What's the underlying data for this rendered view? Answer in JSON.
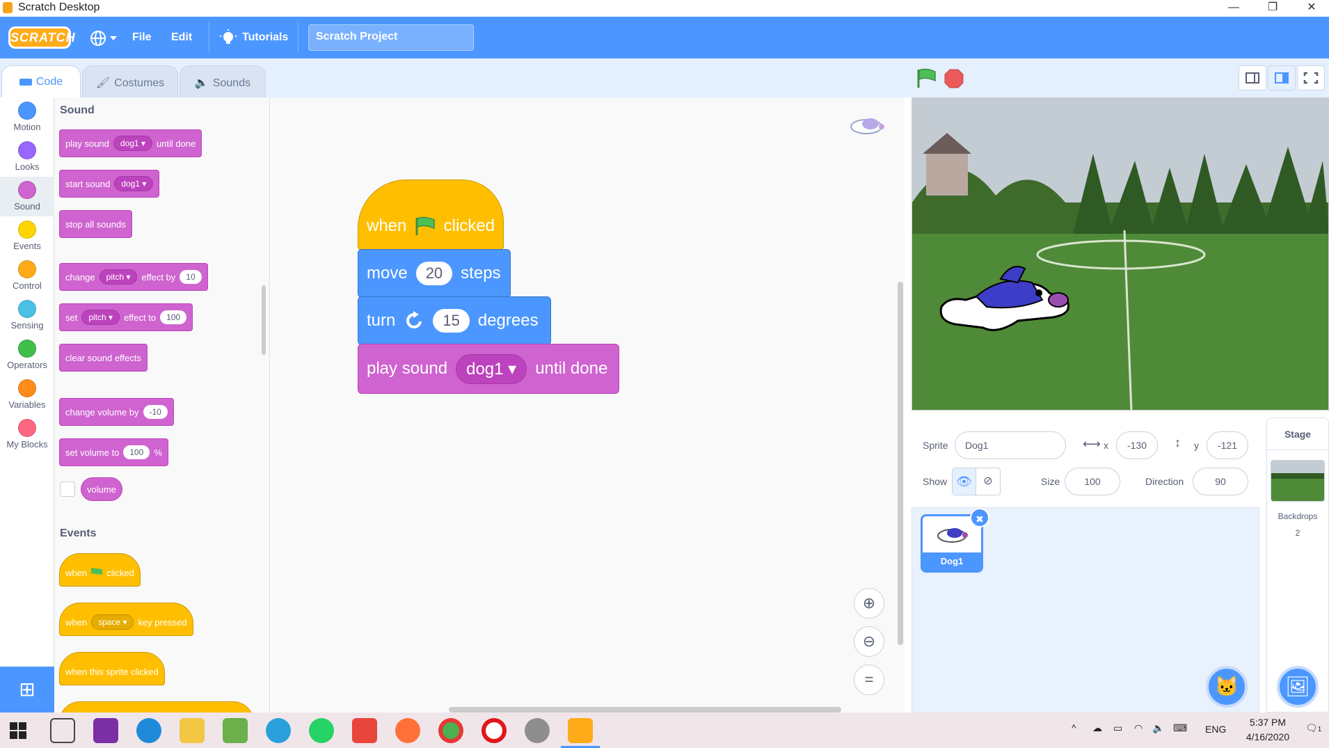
{
  "window": {
    "title": "Scratch Desktop",
    "controls": [
      "—",
      "❐",
      "✕"
    ]
  },
  "menu": {
    "logo": "SCRATCH",
    "file": "File",
    "edit": "Edit",
    "tutorials": "Tutorials",
    "project_name": "Scratch Project"
  },
  "tabs": [
    "Code",
    "Costumes",
    "Sounds"
  ],
  "categories": [
    {
      "label": "Motion",
      "color": "#4c97ff"
    },
    {
      "label": "Looks",
      "color": "#9966ff"
    },
    {
      "label": "Sound",
      "color": "#cf63cf"
    },
    {
      "label": "Events",
      "color": "#ffd500"
    },
    {
      "label": "Control",
      "color": "#ffab19"
    },
    {
      "label": "Sensing",
      "color": "#4cbfe6"
    },
    {
      "label": "Operators",
      "color": "#40bf4a"
    },
    {
      "label": "Variables",
      "color": "#ff8c1a"
    },
    {
      "label": "My Blocks",
      "color": "#ff6680"
    }
  ],
  "palette": {
    "sound_header": "Sound",
    "play_sound": {
      "pre": "play sound",
      "dd": "dog1",
      "post": "until done"
    },
    "start_sound": {
      "pre": "start sound",
      "dd": "dog1"
    },
    "stop_all": "stop all sounds",
    "change_effect": {
      "pre": "change",
      "dd": "pitch",
      "mid": "effect by",
      "val": "10"
    },
    "set_effect": {
      "pre": "set",
      "dd": "pitch",
      "mid": "effect to",
      "val": "100"
    },
    "clear_effects": "clear sound effects",
    "change_volume": {
      "pre": "change volume by",
      "val": "-10"
    },
    "set_volume": {
      "pre": "set volume to",
      "val": "100",
      "post": "%"
    },
    "volume": "volume",
    "events_header": "Events",
    "when_flag": {
      "pre": "when",
      "post": "clicked"
    },
    "when_key": {
      "pre": "when",
      "dd": "space",
      "post": "key pressed"
    },
    "when_sprite": "when this sprite clicked"
  },
  "script": {
    "hat": {
      "pre": "when",
      "post": "clicked"
    },
    "move": {
      "pre": "move",
      "val": "20",
      "post": "steps"
    },
    "turn": {
      "pre": "turn",
      "val": "15",
      "post": "degrees"
    },
    "play": {
      "pre": "play sound",
      "dd": "dog1",
      "post": "until done"
    }
  },
  "sprite_info": {
    "sprite_label": "Sprite",
    "sprite_name": "Dog1",
    "x_label": "x",
    "x": "-130",
    "y_label": "y",
    "y": "-121",
    "show_label": "Show",
    "size_label": "Size",
    "size": "100",
    "direction_label": "Direction",
    "direction": "90"
  },
  "sprites": [
    {
      "name": "Dog1"
    }
  ],
  "stage_pane": {
    "title": "Stage",
    "backdrops_label": "Backdrops",
    "backdrops_count": "2"
  },
  "taskbar": {
    "lang": "ENG",
    "time": "5:37 PM",
    "date": "4/16/2020",
    "notif": "1"
  }
}
